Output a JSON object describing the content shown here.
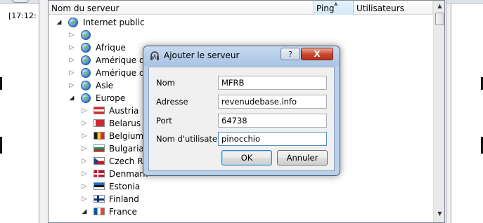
{
  "log": {
    "line": "[17:12:"
  },
  "server_list": {
    "columns": {
      "name": "Nom du serveur",
      "ping": "Ping",
      "users": "Utilisateurs"
    },
    "tree": [
      {
        "label": "Internet public",
        "icon": "globe",
        "expanded": true
      },
      {
        "label": "",
        "icon": "globe",
        "expanded": false
      },
      {
        "label": "Afrique",
        "icon": "globe",
        "expanded": false
      },
      {
        "label": "Amérique du",
        "icon": "globe",
        "expanded": false
      },
      {
        "label": "Amérique du",
        "icon": "globe",
        "expanded": false
      },
      {
        "label": "Asie",
        "icon": "globe",
        "expanded": false
      },
      {
        "label": "Europe",
        "icon": "globe",
        "expanded": true
      },
      {
        "label": "Austria",
        "icon": "flag-austria",
        "expanded": false
      },
      {
        "label": "Belarus",
        "icon": "flag-belarus",
        "expanded": false
      },
      {
        "label": "Belgium",
        "icon": "flag-belgium",
        "expanded": false
      },
      {
        "label": "Bulgaria",
        "icon": "flag-bulgaria",
        "expanded": false
      },
      {
        "label": "Czech Rep",
        "icon": "flag-czech",
        "expanded": false
      },
      {
        "label": "Denmark",
        "icon": "flag-denmark",
        "expanded": false
      },
      {
        "label": "Estonia",
        "icon": "flag-estonia",
        "expanded": false
      },
      {
        "label": "Finland",
        "icon": "flag-finland",
        "expanded": false
      },
      {
        "label": "France",
        "icon": "flag-france",
        "expanded": true
      }
    ]
  },
  "dialog": {
    "title": "Ajouter le serveur",
    "help_label": "?",
    "close_label": "X",
    "fields": {
      "name_label": "Nom",
      "name_value": "MFRB",
      "address_label": "Adresse",
      "address_value": "revenudebase.info",
      "port_label": "Port",
      "port_value": "64738",
      "user_label": "Nom d'utilisateur",
      "user_value": "pinocchio"
    },
    "ok_label": "OK",
    "cancel_label": "Annuler"
  },
  "colors": {
    "accent": "#b9d1ea",
    "close": "#c8442d"
  }
}
